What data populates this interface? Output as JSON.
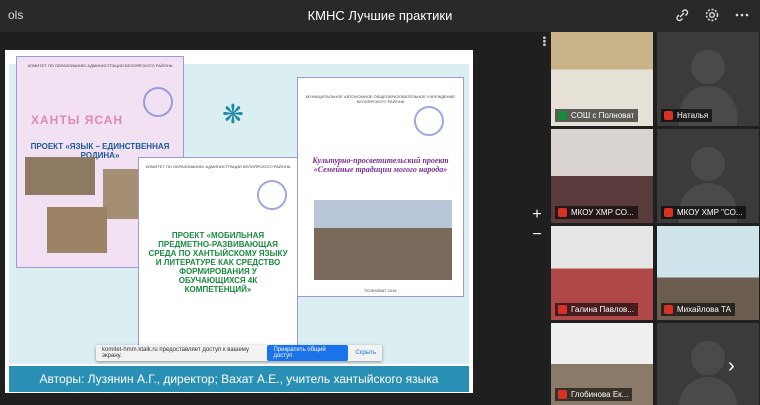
{
  "app": {
    "left_label": "ols",
    "title": "КМНС Лучшие практики"
  },
  "titlebar": {
    "link_icon": "link-icon",
    "settings_icon": "gear-icon",
    "more_icon": "more-horizontal-icon"
  },
  "slide": {
    "footer": "Авторы:  Лузянин А.Г., директор;  Вахат А.Е., учитель хантыйского  языка",
    "doc1_project": "ПРОЕКТ «ЯЗЫК – ЕДИНСТВЕННАЯ РОДИНА»",
    "doc1_header": "КОМИТЕТ ПО ОБРАЗОВАНИЮ АДМИНИСТРАЦИИ БЕЛОЯРСКОГО РАЙОНА",
    "doc1_watermark": "ХАНТЫ ЯСАН",
    "doc2_header": "КОМИТЕТ ПО ОБРАЗОВАНИЮ АДМИНИСТРАЦИИ БЕЛОЯРСКОГО РАЙОНА",
    "doc2_project": "ПРОЕКТ «МОБИЛЬНАЯ ПРЕДМЕТНО-РАЗВИВАЮЩАЯ СРЕДА ПО ХАНТЫЙСКОМУ ЯЗЫКУ И ЛИТЕРАТУРЕ КАК СРЕДСТВО ФОРМИРОВАНИЯ У ОБУЧАЮЩИХСЯ 4К КОМПЕТЕНЦИЙ»",
    "doc3_header": "МУНИЦИПАЛЬНОЕ АВТОНОМНОЕ ОБЩЕОБРАЗОВАТЕЛЬНОЕ УЧРЕЖДЕНИЕ БЕЛОЯРСКОГО РАЙОНА",
    "doc3_project": "Культурно-просветительский проект «Семейные традиции могого народа»",
    "doc3_footer": "ПОЛНОВАТ 2016"
  },
  "notification": {
    "text": "komitet-hmm.ktalk.ru предоставляет доступ к вашему экрану.",
    "stop_button": "Прекратить общий доступ",
    "hide_button": "Скрыть"
  },
  "participants": [
    {
      "name": "СОШ с Полноват",
      "mic": "on",
      "active": true
    },
    {
      "name": "Наталья",
      "mic": "muted",
      "active": false
    },
    {
      "name": "МКОУ ХМР СО...",
      "mic": "muted",
      "active": false
    },
    {
      "name": "МКОУ ХМР \"СО...",
      "mic": "muted",
      "active": false
    },
    {
      "name": "Галина Павлов...",
      "mic": "muted",
      "active": false
    },
    {
      "name": "Михайлова ТА",
      "mic": "muted",
      "active": false
    },
    {
      "name": "Глобинова Ек...",
      "mic": "muted",
      "active": false
    }
  ],
  "controls": {
    "zoom_in": "+",
    "zoom_out": "−",
    "next": "›"
  }
}
